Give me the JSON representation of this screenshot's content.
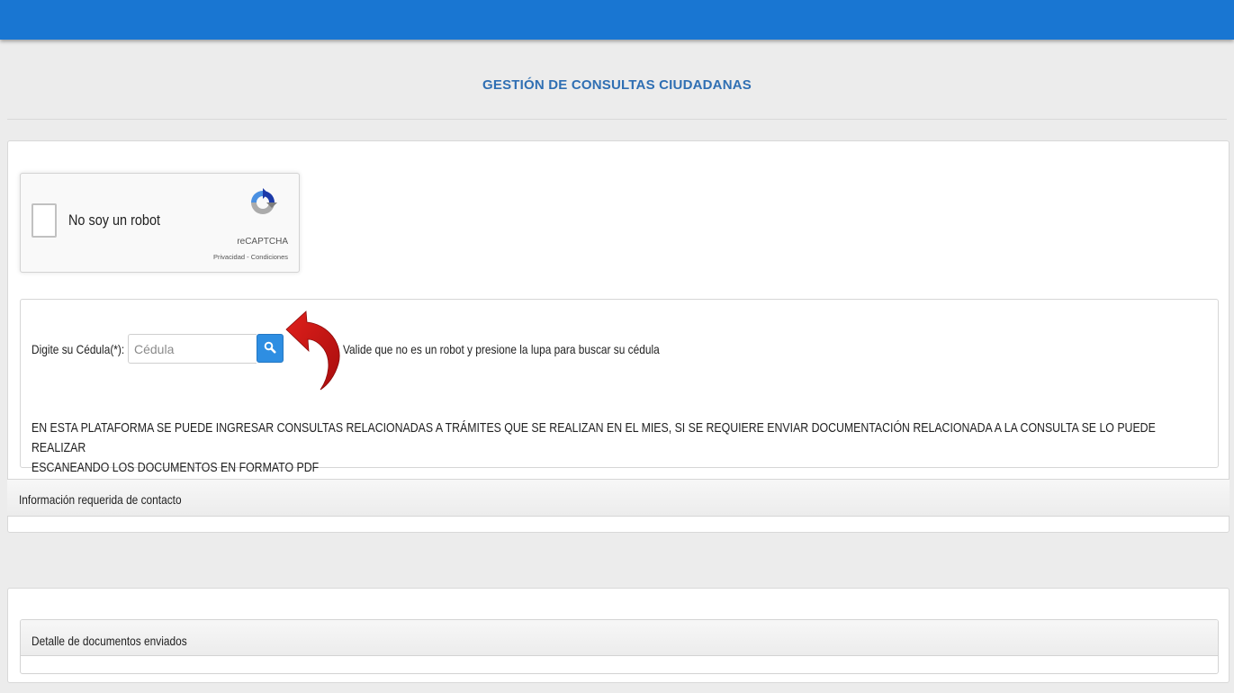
{
  "header": {
    "bar_color": "#1976d2"
  },
  "page": {
    "title": "GESTIÓN DE CONSULTAS CIUDADANAS",
    "title_color": "#2f6fb3"
  },
  "captcha": {
    "label": "No soy un robot",
    "brand": "reCAPTCHA",
    "privacy_link": "Privacidad",
    "separator": " - ",
    "terms_link": "Condiciones",
    "icon": "recaptcha-logo-icon"
  },
  "cedula": {
    "label": "Digite su Cédula(*):",
    "placeholder": "Cédula",
    "value": "",
    "search_icon": "search-icon",
    "hint": "Valide que no es un robot y presione la lupa para buscar su cédula",
    "arrow_icon": "curved-red-arrow-icon",
    "accent": "#2e8ee2"
  },
  "notice": {
    "line1": "EN ESTA PLATAFORMA SE PUEDE INGRESAR CONSULTAS RELACIONADAS A TRÁMITES QUE SE REALIZAN EN EL MIES, SI SE REQUIERE ENVIAR DOCUMENTACIÓN RELACIONADA A LA CONSULTA SE LO PUEDE REALIZAR",
    "line2": "ESCANEANDO LOS DOCUMENTOS EN FORMATO PDF"
  },
  "sections": {
    "contact_title": "Información requerida de contacto",
    "documents_title": "Detalle de documentos enviados"
  }
}
